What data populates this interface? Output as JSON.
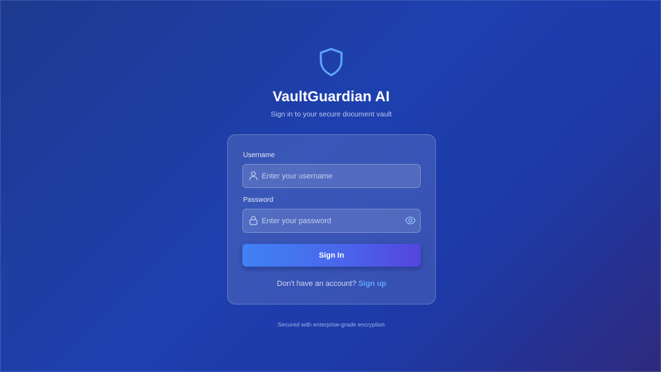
{
  "app": {
    "title": "VaultGuardian AI",
    "subtitle": "Sign in to your secure document vault",
    "logo_icon": "shield-icon",
    "accent_color": "#60a5fa"
  },
  "login_form": {
    "username": {
      "label": "Username",
      "placeholder": "Enter your username",
      "value": "",
      "icon": "user-icon"
    },
    "password": {
      "label": "Password",
      "placeholder": "Enter your password",
      "value": "",
      "icon": "lock-icon",
      "toggle_icon": "eye-icon"
    },
    "submit_label": "Sign In",
    "signup_prompt": "Don't have an account?",
    "signup_link": "Sign up"
  },
  "footer": {
    "note": "Secured with enterprise-grade encryption"
  }
}
